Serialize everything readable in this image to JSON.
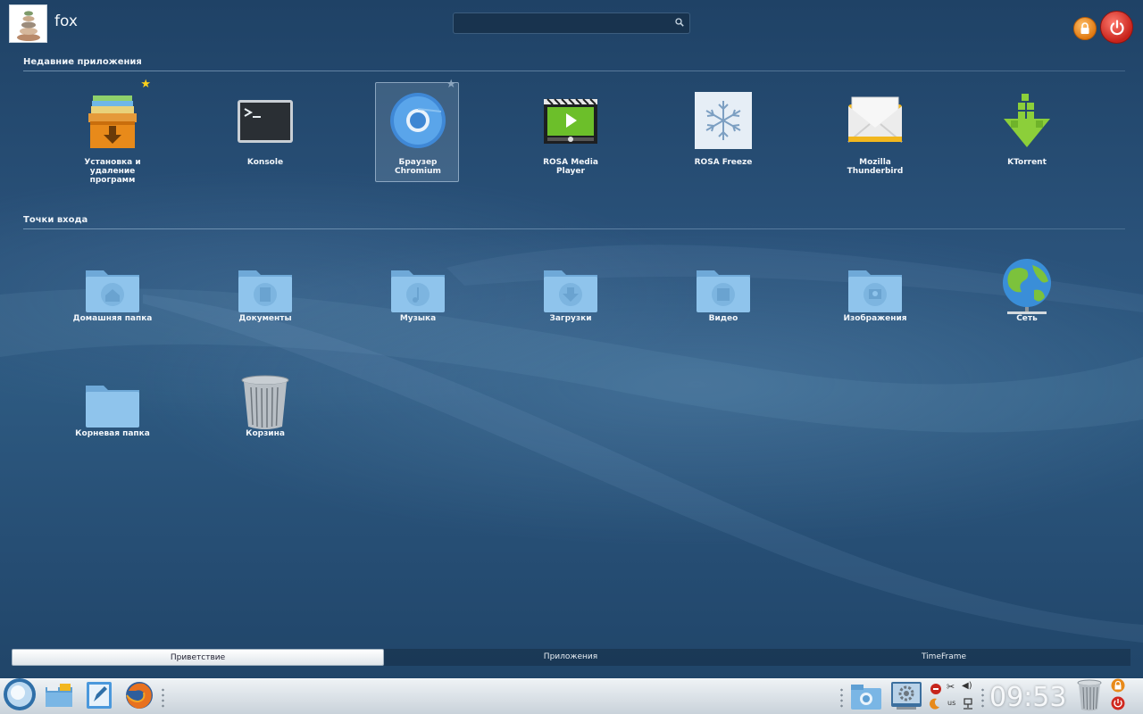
{
  "user": {
    "name": "fox"
  },
  "search": {
    "placeholder": ""
  },
  "sections": {
    "recent": {
      "title": "Недавние приложения"
    },
    "places": {
      "title": "Точки входа"
    }
  },
  "recent_apps": [
    {
      "label": "Установка и\nудаление\nпрограмм",
      "icon": "package-installer-icon",
      "favorite": true
    },
    {
      "label": "Konsole",
      "icon": "terminal-icon"
    },
    {
      "label": "Браузер\nChromium",
      "icon": "chromium-browser-icon",
      "selected": true
    },
    {
      "label": "ROSA Media\nPlayer",
      "icon": "media-player-icon"
    },
    {
      "label": "ROSA Freeze",
      "icon": "snowflake-icon"
    },
    {
      "label": "Mozilla\nThunderbird",
      "icon": "mail-envelope-icon"
    },
    {
      "label": "KTorrent",
      "icon": "download-arrow-icon"
    }
  ],
  "places": [
    {
      "label": "Домашняя папка",
      "icon": "home-folder-icon"
    },
    {
      "label": "Документы",
      "icon": "documents-folder-icon"
    },
    {
      "label": "Музыка",
      "icon": "music-folder-icon"
    },
    {
      "label": "Загрузки",
      "icon": "downloads-folder-icon"
    },
    {
      "label": "Видео",
      "icon": "video-folder-icon"
    },
    {
      "label": "Изображения",
      "icon": "pictures-folder-icon"
    },
    {
      "label": "Сеть",
      "icon": "network-globe-icon"
    },
    {
      "label": "Корневая папка",
      "icon": "root-folder-icon"
    },
    {
      "label": "Корзина",
      "icon": "trash-icon"
    }
  ],
  "tabs": [
    {
      "label": "Приветствие",
      "active": true
    },
    {
      "label": "Приложения",
      "active": false
    },
    {
      "label": "TimeFrame",
      "active": false
    }
  ],
  "panel": {
    "clock": "09:53",
    "keyboard_layout": "us"
  },
  "colors": {
    "folder": "#8fc4ec",
    "accent_orange": "#e88a1a",
    "power_red": "#d0281f"
  }
}
